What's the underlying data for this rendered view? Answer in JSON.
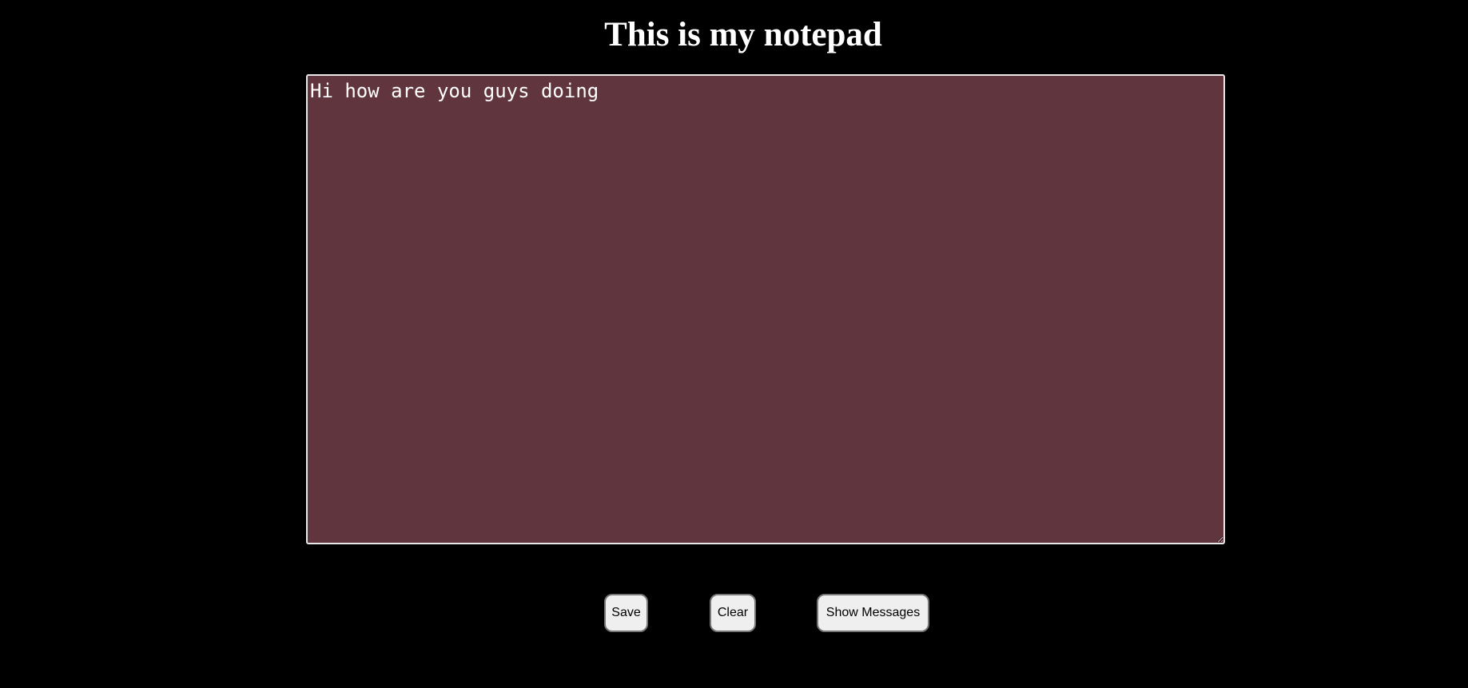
{
  "header": {
    "title": "This is my notepad"
  },
  "notepad": {
    "value": "Hi how are you guys doing"
  },
  "buttons": {
    "save_label": "Save",
    "clear_label": "Clear",
    "show_messages_label": "Show Messages"
  },
  "colors": {
    "background": "#000000",
    "notepad_background": "#61353d",
    "text": "#ffffff",
    "button_background": "#efefef"
  }
}
